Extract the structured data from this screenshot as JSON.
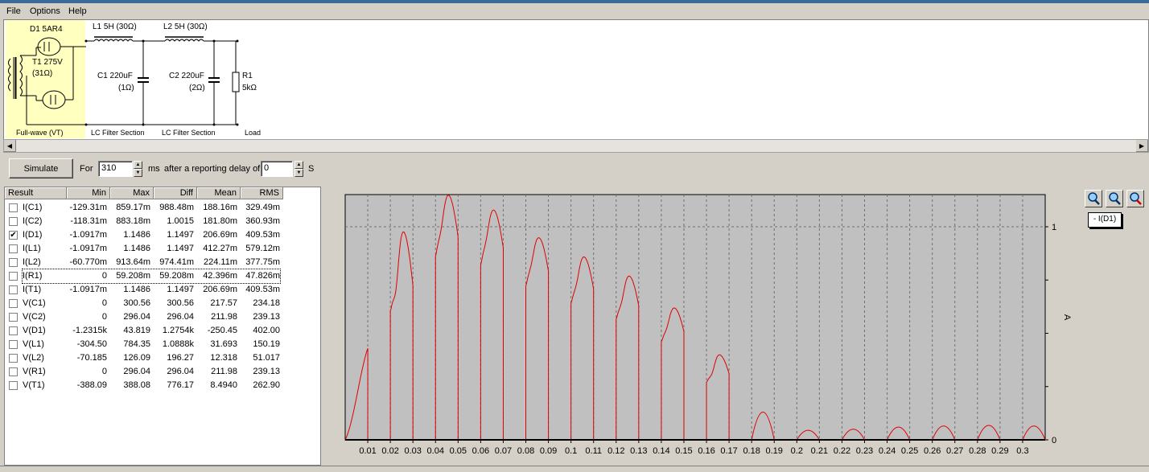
{
  "menu": {
    "file": "File",
    "options": "Options",
    "help": "Help"
  },
  "schematic": {
    "d1": "D1 5AR4",
    "t1": "T1 275V",
    "t1_res": "(31Ω)",
    "l1": "L1 5H (30Ω)",
    "l2": "L2 5H (30Ω)",
    "c1": "C1 220uF",
    "c1_res": "(1Ω)",
    "c2": "C2 220uF",
    "c2_res": "(2Ω)",
    "r1": "R1",
    "r1_val": "5kΩ",
    "sec_rect": "Full-wave (VT)",
    "sec_lc1": "LC Filter Section",
    "sec_lc2": "LC Filter Section",
    "sec_load": "Load"
  },
  "controls": {
    "simulate": "Simulate",
    "for": "For",
    "duration": "310",
    "ms": "ms",
    "delay_text": "after a reporting delay of",
    "delay": "0",
    "s": "S"
  },
  "table": {
    "headers": [
      "Result",
      "Min",
      "Max",
      "Diff",
      "Mean",
      "RMS"
    ],
    "rows": [
      {
        "name": "I(C1)",
        "checked": false,
        "min": "-129.31m",
        "max": "859.17m",
        "diff": "988.48m",
        "mean": "188.16m",
        "rms": "329.49m"
      },
      {
        "name": "I(C2)",
        "checked": false,
        "min": "-118.31m",
        "max": "883.18m",
        "diff": "1.0015",
        "mean": "181.80m",
        "rms": "360.93m"
      },
      {
        "name": "I(D1)",
        "checked": true,
        "min": "-1.0917m",
        "max": "1.1486",
        "diff": "1.1497",
        "mean": "206.69m",
        "rms": "409.53m"
      },
      {
        "name": "I(L1)",
        "checked": false,
        "min": "-1.0917m",
        "max": "1.1486",
        "diff": "1.1497",
        "mean": "412.27m",
        "rms": "579.12m"
      },
      {
        "name": "I(L2)",
        "checked": false,
        "min": "-60.770m",
        "max": "913.64m",
        "diff": "974.41m",
        "mean": "224.11m",
        "rms": "377.75m"
      },
      {
        "name": "I(R1)",
        "checked": false,
        "min": "0",
        "max": "59.208m",
        "diff": "59.208m",
        "mean": "42.396m",
        "rms": "47.826m"
      },
      {
        "name": "I(T1)",
        "checked": false,
        "min": "-1.0917m",
        "max": "1.1486",
        "diff": "1.1497",
        "mean": "206.69m",
        "rms": "409.53m"
      },
      {
        "name": "V(C1)",
        "checked": false,
        "min": "0",
        "max": "300.56",
        "diff": "300.56",
        "mean": "217.57",
        "rms": "234.18"
      },
      {
        "name": "V(C2)",
        "checked": false,
        "min": "0",
        "max": "296.04",
        "diff": "296.04",
        "mean": "211.98",
        "rms": "239.13"
      },
      {
        "name": "V(D1)",
        "checked": false,
        "min": "-1.2315k",
        "max": "43.819",
        "diff": "1.2754k",
        "mean": "-250.45",
        "rms": "402.00"
      },
      {
        "name": "V(L1)",
        "checked": false,
        "min": "-304.50",
        "max": "784.35",
        "diff": "1.0888k",
        "mean": "31.693",
        "rms": "150.19"
      },
      {
        "name": "V(L2)",
        "checked": false,
        "min": "-70.185",
        "max": "126.09",
        "diff": "196.27",
        "mean": "12.318",
        "rms": "51.017"
      },
      {
        "name": "V(R1)",
        "checked": false,
        "min": "0",
        "max": "296.04",
        "diff": "296.04",
        "mean": "211.98",
        "rms": "239.13"
      },
      {
        "name": "V(T1)",
        "checked": false,
        "min": "-388.09",
        "max": "388.08",
        "diff": "776.17",
        "mean": "8.4940",
        "rms": "262.90"
      }
    ]
  },
  "legend": "- I(D1)",
  "colors": {
    "trace": "#e00000",
    "plot_bg": "#c0c0c0"
  },
  "chart_data": {
    "type": "line",
    "series": [
      {
        "name": "I(D1)",
        "pulses": [
          {
            "t0": 0.0,
            "t1": 0.01,
            "peak": 0.43,
            "dip": 0.43
          },
          {
            "t0": 0.02,
            "t1": 0.03,
            "peak": 0.98,
            "dip": 0.74
          },
          {
            "t0": 0.04,
            "t1": 0.05,
            "peak": 1.15,
            "dip": 1.05
          },
          {
            "t0": 0.06,
            "t1": 0.07,
            "peak": 1.08,
            "dip": 1.0
          },
          {
            "t0": 0.08,
            "t1": 0.09,
            "peak": 0.95,
            "dip": 0.88
          },
          {
            "t0": 0.1,
            "t1": 0.11,
            "peak": 0.86,
            "dip": 0.78
          },
          {
            "t0": 0.12,
            "t1": 0.13,
            "peak": 0.77,
            "dip": 0.69
          },
          {
            "t0": 0.14,
            "t1": 0.15,
            "peak": 0.62,
            "dip": 0.56
          },
          {
            "t0": 0.16,
            "t1": 0.17,
            "peak": 0.4,
            "dip": 0.33
          },
          {
            "t0": 0.18,
            "t1": 0.19,
            "peak": 0.13,
            "dip": 0.07
          },
          {
            "t0": 0.2,
            "t1": 0.21,
            "peak": 0.045,
            "dip": 0.045
          },
          {
            "t0": 0.22,
            "t1": 0.23,
            "peak": 0.05,
            "dip": 0.05
          },
          {
            "t0": 0.24,
            "t1": 0.25,
            "peak": 0.06,
            "dip": 0.06
          },
          {
            "t0": 0.26,
            "t1": 0.27,
            "peak": 0.065,
            "dip": 0.065
          },
          {
            "t0": 0.28,
            "t1": 0.29,
            "peak": 0.068,
            "dip": 0.068
          },
          {
            "t0": 0.3,
            "t1": 0.31,
            "peak": 0.065,
            "dip": 0.065
          }
        ]
      }
    ],
    "xlim": [
      0,
      0.31
    ],
    "ylim": [
      0,
      1.15
    ],
    "x_ticks": [
      "0.01",
      "0.02",
      "0.03",
      "0.04",
      "0.05",
      "0.06",
      "0.07",
      "0.08",
      "0.09",
      "0.1",
      "0.11",
      "0.12",
      "0.13",
      "0.14",
      "0.15",
      "0.16",
      "0.17",
      "0.18",
      "0.19",
      "0.2",
      "0.21",
      "0.22",
      "0.23",
      "0.24",
      "0.25",
      "0.26",
      "0.27",
      "0.28",
      "0.29",
      "0.3"
    ],
    "y_ticks": [
      "1",
      "0"
    ],
    "ylabel": "A",
    "grid": true
  }
}
